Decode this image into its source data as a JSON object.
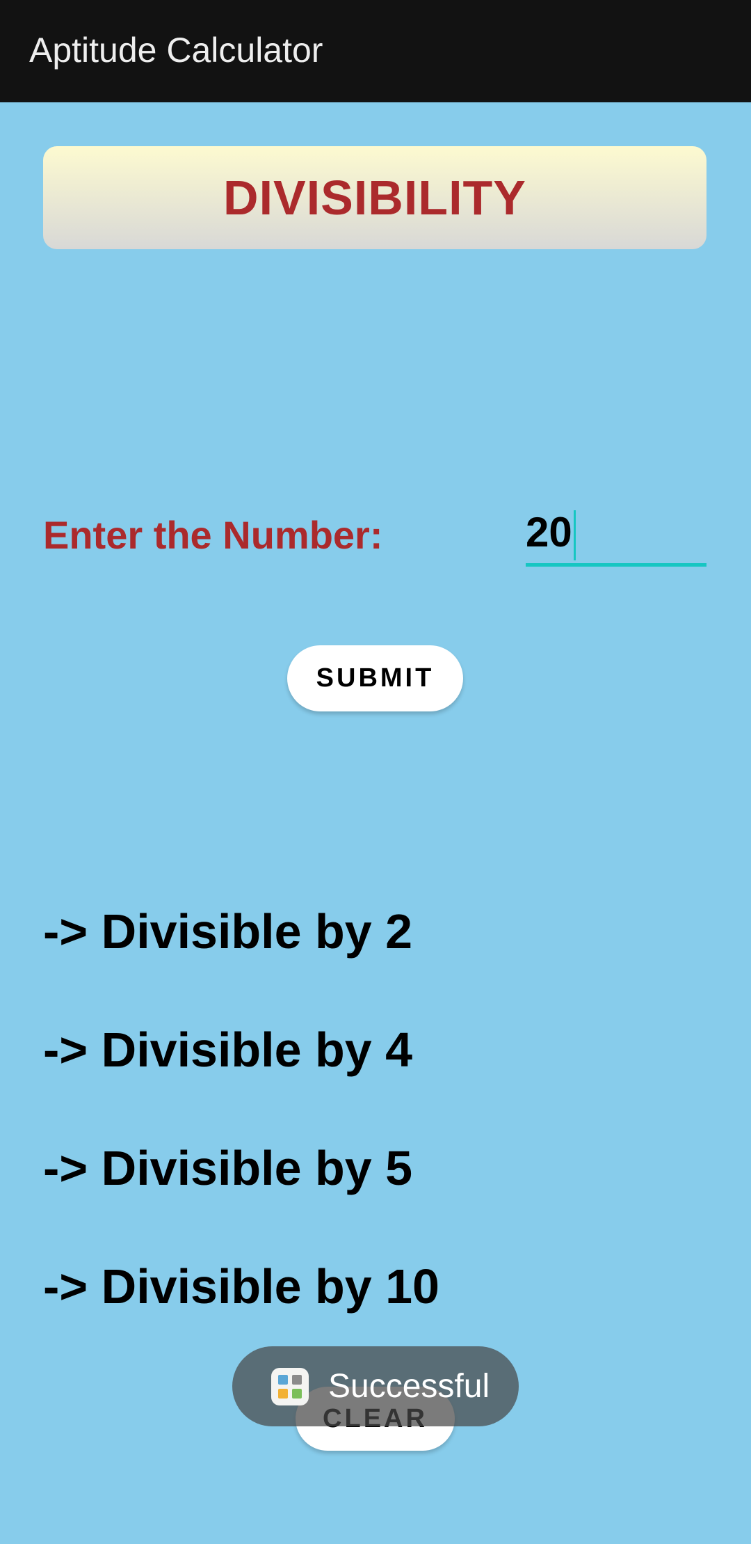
{
  "app_bar": {
    "title": "Aptitude Calculator"
  },
  "header": {
    "title": "DIVISIBILITY"
  },
  "form": {
    "label": "Enter the Number:",
    "value": "20",
    "submit_label": "SUBMIT"
  },
  "results": [
    "-> Divisible by 2",
    "-> Divisible by 4",
    "-> Divisible by 5",
    "-> Divisible by 10"
  ],
  "clear_label": "CLEAR",
  "toast": {
    "message": "Successful",
    "icon": "app-icon"
  },
  "colors": {
    "background": "#87cceb",
    "app_bar": "#121212",
    "accent_red": "#ab2a2c",
    "field_underline": "#16c6c2"
  }
}
